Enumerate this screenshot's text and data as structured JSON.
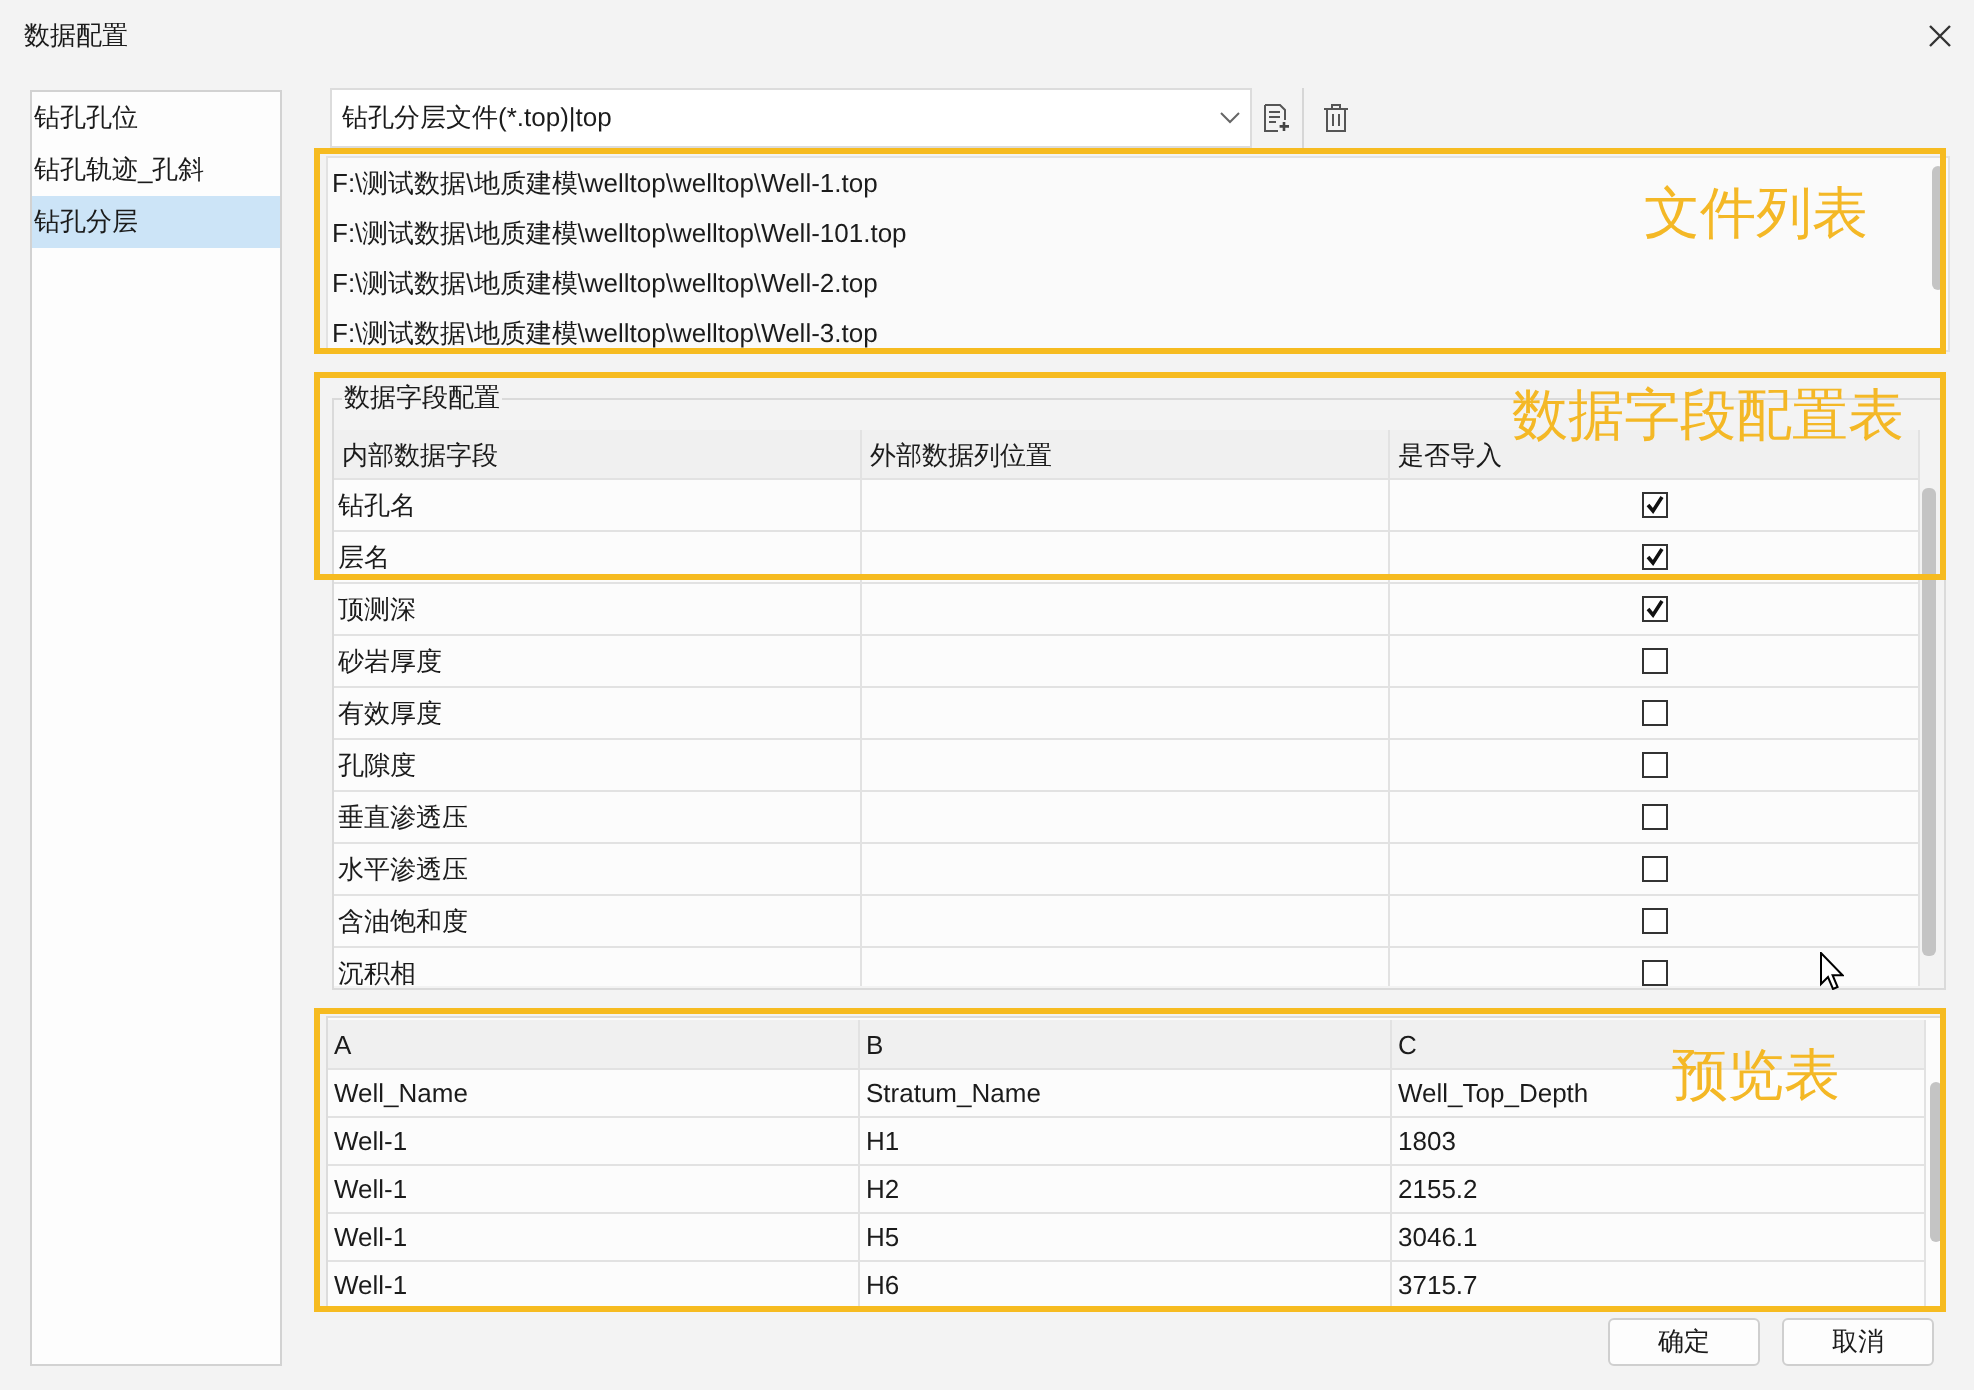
{
  "window": {
    "title": "数据配置"
  },
  "sidebar": {
    "items": [
      {
        "label": "钻孔孔位",
        "selected": false
      },
      {
        "label": "钻孔轨迹_孔斜",
        "selected": false
      },
      {
        "label": "钻孔分层",
        "selected": true
      }
    ]
  },
  "file_type": {
    "value": "钻孔分层文件(*.top)|top"
  },
  "file_list": {
    "items": [
      "F:\\测试数据\\地质建模\\welltop\\welltop\\Well-1.top",
      "F:\\测试数据\\地质建模\\welltop\\welltop\\Well-101.top",
      "F:\\测试数据\\地质建模\\welltop\\welltop\\Well-2.top",
      "F:\\测试数据\\地质建模\\welltop\\welltop\\Well-3.top"
    ]
  },
  "field_config": {
    "title": "数据字段配置",
    "columns": [
      "内部数据字段",
      "外部数据列位置",
      "是否导入"
    ],
    "rows": [
      {
        "field": "钻孔名",
        "checked": true
      },
      {
        "field": "层名",
        "checked": true
      },
      {
        "field": "顶测深",
        "checked": true
      },
      {
        "field": "砂岩厚度",
        "checked": false
      },
      {
        "field": "有效厚度",
        "checked": false
      },
      {
        "field": "孔隙度",
        "checked": false
      },
      {
        "field": "垂直渗透压",
        "checked": false
      },
      {
        "field": "水平渗透压",
        "checked": false
      },
      {
        "field": "含油饱和度",
        "checked": false
      },
      {
        "field": "沉积相",
        "checked": false
      }
    ]
  },
  "preview": {
    "columns": [
      "A",
      "B",
      "C"
    ],
    "rows": [
      [
        "Well_Name",
        "Stratum_Name",
        "Well_Top_Depth"
      ],
      [
        "Well-1",
        "H1",
        "1803"
      ],
      [
        "Well-1",
        "H2",
        "2155.2"
      ],
      [
        "Well-1",
        "H5",
        "3046.1"
      ],
      [
        "Well-1",
        "H6",
        "3715.7"
      ]
    ]
  },
  "buttons": [
    {
      "label": "确定"
    },
    {
      "label": "取消"
    }
  ],
  "annotations": [
    {
      "label": "文件列表"
    },
    {
      "label": "数据字段配置表"
    },
    {
      "label": "预览表"
    }
  ]
}
